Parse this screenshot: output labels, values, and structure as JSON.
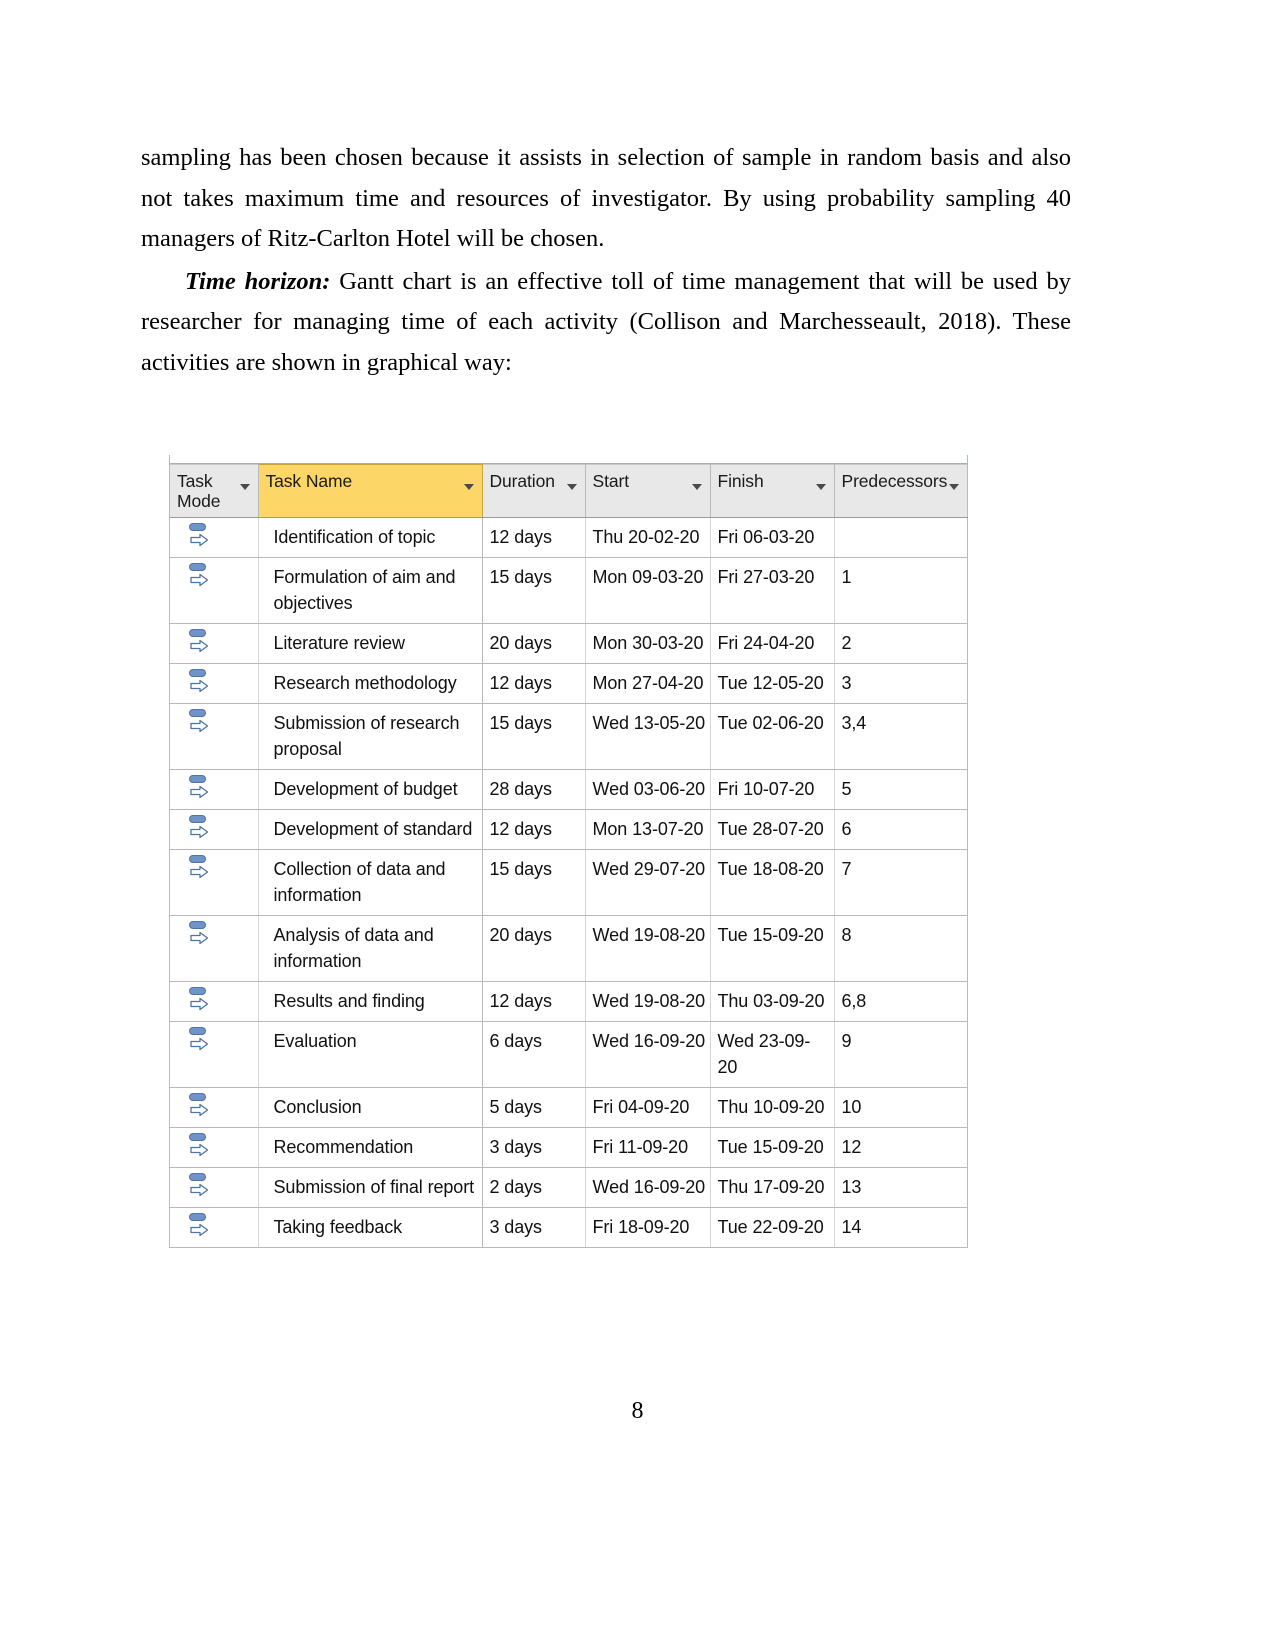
{
  "document": {
    "page_number": "8",
    "paragraphs": [
      {
        "id": "p1",
        "indent": false,
        "lead_bold_italic": "",
        "text": "sampling has been chosen because it assists in selection of sample in random basis and also not takes maximum time and resources of investigator. By using probability sampling 40 managers of Ritz-Carlton Hotel will be chosen."
      },
      {
        "id": "p2",
        "indent": true,
        "lead_bold_italic": "Time horizon:",
        "text": " Gantt chart is an effective toll of time management that will be used by researcher for managing time of each activity (Collison and Marchesseault, 2018). These activities are shown in graphical way:"
      }
    ]
  },
  "gantt": {
    "columns": [
      {
        "key": "mode",
        "label": "Task Mode",
        "has_filter": true,
        "highlight": false
      },
      {
        "key": "name",
        "label": "Task Name",
        "has_filter": true,
        "highlight": true
      },
      {
        "key": "dur",
        "label": "Duration",
        "has_filter": true,
        "highlight": false
      },
      {
        "key": "start",
        "label": "Start",
        "has_filter": true,
        "highlight": false
      },
      {
        "key": "finish",
        "label": "Finish",
        "has_filter": true,
        "highlight": false
      },
      {
        "key": "pred",
        "label": "Predecessors",
        "has_filter": true,
        "highlight": false
      }
    ],
    "highlight_color": "#fcd666",
    "header_color": "#e8e8e8",
    "icon_color": "#6f94c8",
    "task_mode_icon": "auto-schedule-icon",
    "rows": [
      {
        "name": "Identification of topic",
        "duration": "12 days",
        "start": "Thu 20-02-20",
        "finish": "Fri 06-03-20",
        "predecessors": ""
      },
      {
        "name": "Formulation of aim and objectives",
        "duration": "15 days",
        "start": "Mon 09-03-20",
        "finish": "Fri 27-03-20",
        "predecessors": "1"
      },
      {
        "name": "Literature review",
        "duration": "20 days",
        "start": "Mon 30-03-20",
        "finish": "Fri 24-04-20",
        "predecessors": "2"
      },
      {
        "name": "Research methodology",
        "duration": "12 days",
        "start": "Mon 27-04-20",
        "finish": "Tue 12-05-20",
        "predecessors": "3"
      },
      {
        "name": "Submission of research proposal",
        "duration": "15 days",
        "start": "Wed 13-05-20",
        "finish": "Tue 02-06-20",
        "predecessors": "3,4"
      },
      {
        "name": "Development of budget",
        "duration": "28 days",
        "start": "Wed 03-06-20",
        "finish": "Fri 10-07-20",
        "predecessors": "5"
      },
      {
        "name": "Development of standard",
        "duration": "12 days",
        "start": "Mon 13-07-20",
        "finish": "Tue 28-07-20",
        "predecessors": "6"
      },
      {
        "name": "Collection of data and information",
        "duration": "15 days",
        "start": "Wed 29-07-20",
        "finish": "Tue 18-08-20",
        "predecessors": "7"
      },
      {
        "name": "Analysis of data and information",
        "duration": "20 days",
        "start": "Wed 19-08-20",
        "finish": "Tue 15-09-20",
        "predecessors": "8"
      },
      {
        "name": "Results and finding",
        "duration": "12 days",
        "start": "Wed 19-08-20",
        "finish": "Thu 03-09-20",
        "predecessors": "6,8"
      },
      {
        "name": "Evaluation",
        "duration": "6 days",
        "start": "Wed 16-09-20",
        "finish": "Wed 23-09-20",
        "predecessors": "9"
      },
      {
        "name": "Conclusion",
        "duration": "5 days",
        "start": "Fri 04-09-20",
        "finish": "Thu 10-09-20",
        "predecessors": "10"
      },
      {
        "name": "Recommendation",
        "duration": "3 days",
        "start": "Fri 11-09-20",
        "finish": "Tue 15-09-20",
        "predecessors": "12"
      },
      {
        "name": "Submission of final report",
        "duration": "2 days",
        "start": "Wed 16-09-20",
        "finish": "Thu 17-09-20",
        "predecessors": "13"
      },
      {
        "name": "Taking feedback",
        "duration": "3 days",
        "start": "Fri 18-09-20",
        "finish": "Tue 22-09-20",
        "predecessors": "14"
      }
    ]
  }
}
